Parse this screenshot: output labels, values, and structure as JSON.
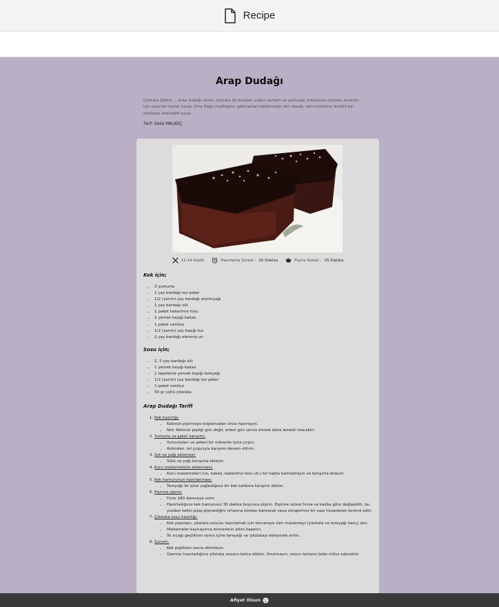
{
  "window": {
    "title": "Recipe",
    "icon": "document-icon"
  },
  "recipe": {
    "title": "Arap Dudağı",
    "intro": "Çikolata Şöleni ... Arap dudağı tatlısı, çikolata ile buluşan yoğun şerbeti ve yumuşak dokusuyla çikolata severler için eşsiz bir lezzet sunar. Orta Doğu mutfağının geleneksel tatlılarından biri olarak, tatlı krizlerine lezzetli bir çikolatalı alternatif sunar.",
    "author": "Tarif: Seda MALKOÇ",
    "meta": {
      "servings": "12-14 kişilik",
      "prep_label": "Hazırlama Süresi :",
      "prep_value": "20 Dakika",
      "cook_label": "Pişme Süresi :",
      "cook_value": "25 Dakika",
      "icons": [
        "utensils-icon",
        "alarm-clock-icon",
        "cooking-pot-icon"
      ]
    },
    "cake_heading": "Kek için;",
    "cake_ingredients": [
      "3 yumurta",
      "1 çay bardağı toz şeker",
      "1/2 (yarım) çay bardağı zeytinyağı",
      "1 çay bardağı süt",
      "1 paket kabartma tozu",
      "2 yemek kaşığı kakao",
      "1 paket vanilya",
      "1/2 (yarım) çay kaşığı tuz",
      "2 çay bardağı elenmiş un"
    ],
    "sauce_heading": "Sosu için;",
    "sauce_ingredients": [
      "2, 5 çay bardağı süt",
      "1 yemek kaşığı kakao",
      "1 tepeleme yemek kaşığı tereyağı",
      "1/2 (yarım) çay bardağı toz şeker",
      "1 paket vanilya",
      "50 gr sütlü çikolata"
    ],
    "steps_heading": "Arap Dudağı Tarifi",
    "steps": [
      {
        "title": "Kek hazırlığı:",
        "items": [
          "Kekinizi pişirmeye başlamadan önce hazırlayın.",
          "Not: Kekinizi piştiği gün değil, ertesi gün servis etmek daha lezzetli olacaktır."
        ]
      },
      {
        "title": "Yumurta ve şeker karışımı:",
        "items": [
          "Yumurtaları ve şekeri bir mikserle iyice çırpın.",
          "Ardından, tel çırpıcıyla karışımı devam ettirin."
        ]
      },
      {
        "title": "Süt ve yağı eklemesi:",
        "items": [
          "Sütü ve yağı karışıma ekleyin."
        ]
      },
      {
        "title": "Kuru malzemelerin eklenmesi:",
        "items": [
          "Kuru malzemeleri (un, kakao, kabartma tozu vb.) bir kapta harmanlayın ve karışıma ekleyin."
        ]
      },
      {
        "title": "Kek hamurunun hazırlanması:",
        "items": [
          "Tereyağı ile iyice yağladığınız bir kek kalıbına karışımı dökün."
        ]
      },
      {
        "title": "Pişirme işlemi:",
        "items": [
          "Fırını 180 dereceye ısıtın.",
          "Hazırladığınız kek hamurunu 30 dakika boyunca pişirin. Pişirme süresi fırına ve kalıba göre değişebilir, bu yüzden kekin pişip pişmediğini ortasına kürdan batırarak veya süngerimsi bir yapı hissederek kontrol edin."
        ]
      },
      {
        "title": "Çikolata sosu hazırlığı:",
        "items": [
          "Kek pişerken, çikolata sosunu hazırlamak için tencereye tüm malzemeyi (çikolata ve tereyağı hariç) alın.",
          "Malzemeler kaynayınca tencerenin altını kapatın.",
          "İlk sıcağı geçtikten sonra içine tereyağı ve çikolatayı ekleyerek eritin."
        ]
      },
      {
        "title": "Sunum:",
        "items": [
          "Kek piştikten sonra dilimleyin.",
          "Üzerine hazırladığınız çikolata sosunu bolca dökün. Unutmayın, sosun tamamı keke nüfuz edecektir."
        ]
      }
    ]
  },
  "footer": {
    "text": "Afiyet Olsun",
    "icon": "smiley-icon"
  },
  "colors": {
    "background": "#b9b0c6",
    "card": "#dcdcdc",
    "footer": "#3a3a3a",
    "titlebar": "#f3f3f3"
  }
}
